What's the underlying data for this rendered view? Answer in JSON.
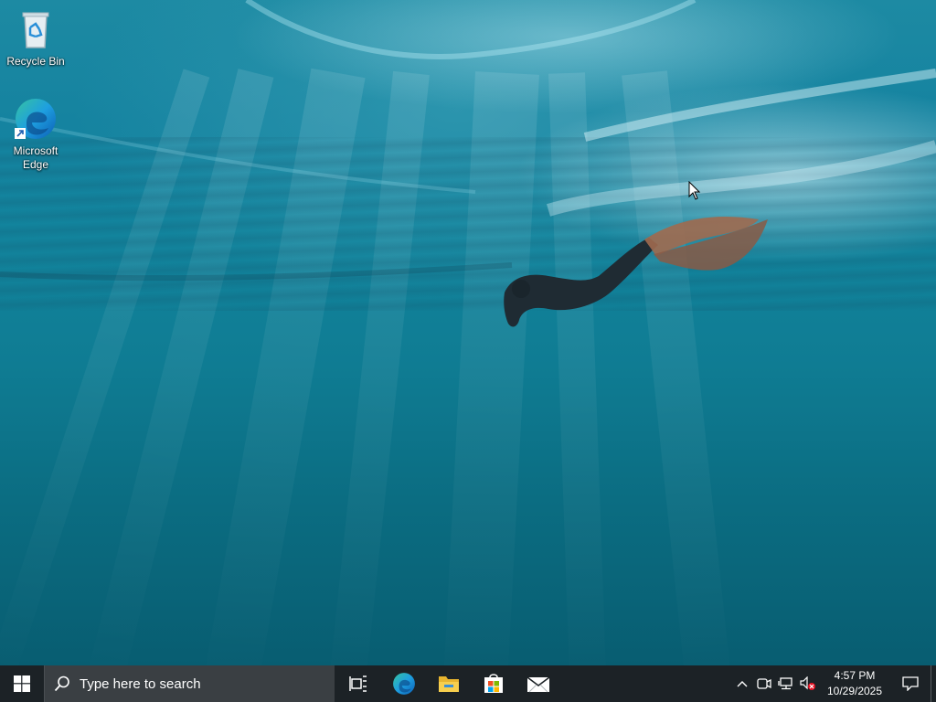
{
  "desktop": {
    "icons": [
      {
        "label": "Recycle Bin",
        "icon": "recycle-bin-icon"
      },
      {
        "label": "Microsoft Edge",
        "icon": "edge-icon"
      }
    ],
    "wallpaper": "underwater-swimmer"
  },
  "taskbar": {
    "start_icon": "windows-logo-icon",
    "search": {
      "placeholder": "Type here to search",
      "icon": "search-icon"
    },
    "pinned": [
      {
        "name": "Task View",
        "icon": "task-view-icon"
      },
      {
        "name": "Microsoft Edge",
        "icon": "edge-icon"
      },
      {
        "name": "File Explorer",
        "icon": "folder-icon"
      },
      {
        "name": "Microsoft Store",
        "icon": "store-icon"
      },
      {
        "name": "Mail",
        "icon": "mail-icon"
      }
    ],
    "tray": {
      "time": "4:57 PM",
      "date": "10/29/2025",
      "icons": [
        "chevron-up-icon",
        "meet-now-icon",
        "network-icon",
        "volume-muted-icon",
        "notification-icon"
      ]
    }
  },
  "colors": {
    "taskbar": "#1c2226",
    "search_box": "#3a3f43",
    "water": "#12849d"
  }
}
